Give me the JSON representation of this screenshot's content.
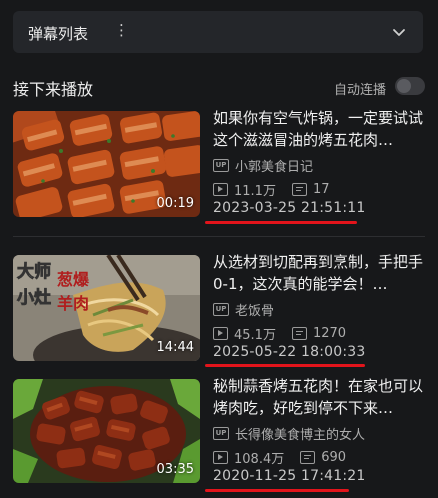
{
  "danmaku": {
    "title": "弹幕列表",
    "menu": "⋮"
  },
  "next": {
    "header": "接下来播放",
    "autoplay_label": "自动连播",
    "autoplay_on": false
  },
  "videos": [
    {
      "title": "如果你有空气炸锅，一定要试试这个滋滋冒油的烤五花肉…",
      "uploader": "小郭美食日记",
      "views": "11.1万",
      "danmaku_count": "17",
      "datetime": "2023-03-25 21:51:11",
      "duration": "00:19",
      "up_badge": "UP"
    },
    {
      "title": "从选材到切配再到烹制，手把手0-1，这次真的能学会！…",
      "uploader": "老饭骨",
      "views": "45.1万",
      "danmaku_count": "1270",
      "datetime": "2025-05-22 18:00:33",
      "duration": "14:44",
      "up_badge": "UP",
      "thumb_text": [
        "大师",
        "小灶",
        "葱爆",
        "羊肉"
      ]
    },
    {
      "title": "秘制蒜香烤五花肉！在家也可以烤肉吃，好吃到停不下来…",
      "uploader": "长得像美食博主的女人",
      "views": "108.4万",
      "danmaku_count": "690",
      "datetime": "2020-11-25 17:41:21",
      "duration": "03:35",
      "up_badge": "UP"
    }
  ],
  "colors": {
    "accent_underline": "#e3141b",
    "background": "#17181a"
  }
}
